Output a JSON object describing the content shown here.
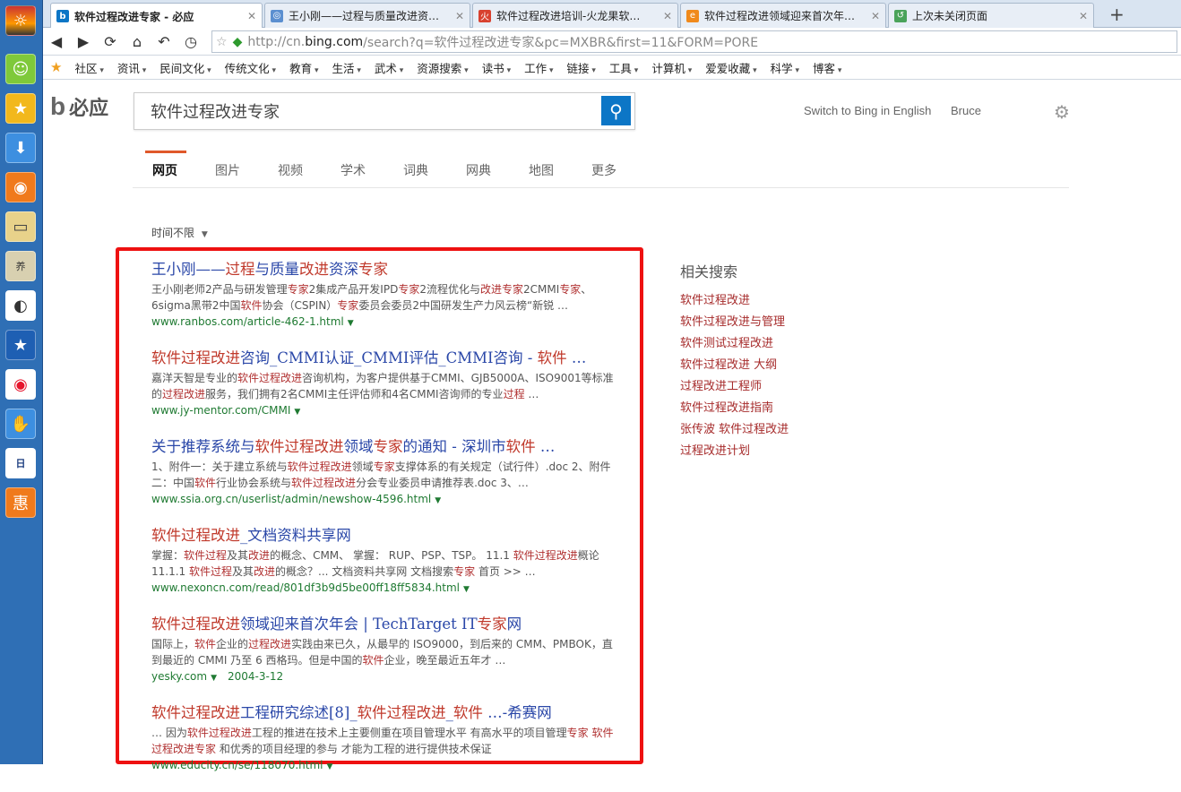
{
  "browser": {
    "tabs": [
      {
        "label": "软件过程改进专家 - 必应",
        "active": true,
        "icon": "bing-icon"
      },
      {
        "label": "王小刚——过程与质量改进资…",
        "active": false,
        "icon": "web-icon"
      },
      {
        "label": "软件过程改进培训-火龙果软…",
        "active": false,
        "icon": "fire-icon"
      },
      {
        "label": "软件过程改进领域迎来首次年…",
        "active": false,
        "icon": "ie-icon"
      },
      {
        "label": "上次未关闭页面",
        "active": false,
        "icon": "restore-icon"
      }
    ],
    "new_tab": "+",
    "url": {
      "prefix": "http://cn.",
      "domain": "bing.com",
      "suffix": "/search?q=软件过程改进专家&pc=MXBR&first=11&FORM=PORE"
    },
    "bookmarks": [
      "社区",
      "资讯",
      "民间文化",
      "传统文化",
      "教育",
      "生活",
      "武术",
      "资源搜索",
      "读书",
      "工作",
      "链接",
      "工具",
      "计算机",
      "爱爱收藏",
      "科学",
      "博客"
    ]
  },
  "page": {
    "logo": "必应",
    "logo_mark": "b",
    "search_value": "软件过程改进专家",
    "switch_lang": "Switch to Bing in English",
    "user": "Bruce",
    "scopes": [
      "网页",
      "图片",
      "视频",
      "学术",
      "词典",
      "网典",
      "地图",
      "更多"
    ],
    "time_filter": "时间不限",
    "results": [
      {
        "title": "王小刚——过程与质量改进资深专家",
        "snippet": "王小刚老师2产品与研发管理专家2集成产品开发IPD专家2流程优化与改进专家2CMMI专家、6sigma黑带2中国软件协会（CSPIN）专家委员会委员2中国研发生产力风云榜“新锐 …",
        "url": "www.ranbos.com/article-462-1.html",
        "date": ""
      },
      {
        "title": "软件过程改进咨询_CMMI认证_CMMI评估_CMMI咨询 - 软件 …",
        "snippet": "嘉洋天智是专业的软件过程改进咨询机构，为客户提供基于CMMI、GJB5000A、ISO9001等标准的过程改进服务，我们拥有2名CMMI主任评估师和4名CMMI咨询师的专业过程 …",
        "url": "www.jy-mentor.com/CMMI",
        "date": ""
      },
      {
        "title": "关于推荐系统与软件过程改进领域专家的通知 - 深圳市软件 …",
        "snippet": "1、附件一：关于建立系统与软件过程改进领域专家支撑体系的有关规定（试行件）.doc 2、附件二：中国软件行业协会系统与软件过程改进分会专业委员申请推荐表.doc 3、…",
        "url": "www.ssia.org.cn/userlist/admin/newshow-4596.html",
        "date": ""
      },
      {
        "title": "软件过程改进_文档资料共享网",
        "snippet": "掌握：软件过程及其改进的概念、CMM、 掌握： RUP、PSP、TSP。 11.1 软件过程改进概论 11.1.1 软件过程及其改进的概念？... 文档资料共享网 文档搜索专家 首页 >> …",
        "url": "www.nexoncn.com/read/801df3b9d5be00ff18ff5834.html",
        "date": ""
      },
      {
        "title": "软件过程改进领域迎来首次年会 | TechTarget IT专家网",
        "snippet": "国际上，软件企业的过程改进实践由来已久，从最早的 ISO9000，到后来的 CMM、PMBOK，直到最近的 CMMI 乃至 6 西格玛。但是中国的软件企业，晚至最近五年才 …",
        "url": "yesky.com",
        "date": "2004-3-12"
      },
      {
        "title": "软件过程改进工程研究综述[8]_软件过程改进_软件 …-希赛网",
        "snippet": "… 因为软件过程改进工程的推进在技术上主要侧重在项目管理水平 有高水平的项目管理专家 软件过程改进专家 和优秀的项目经理的参与 才能为工程的进行提供技术保证",
        "url": "www.educity.cn/se/118070.html",
        "date": ""
      }
    ],
    "related_title": "相关搜索",
    "related": [
      "软件过程改进",
      "软件过程改进与管理",
      "软件测试过程改进",
      "软件过程改进 大纲",
      "过程改进工程师",
      "软件过程改进指南",
      "张传波 软件过程改进",
      "过程改进计划"
    ],
    "colors": {
      "highlight_box": "#ee1111",
      "link": "#2a47a8",
      "keyword": "#c0392b",
      "url": "#1f7a32",
      "accent": "#e0582a",
      "search_button": "#0c76c6"
    }
  }
}
